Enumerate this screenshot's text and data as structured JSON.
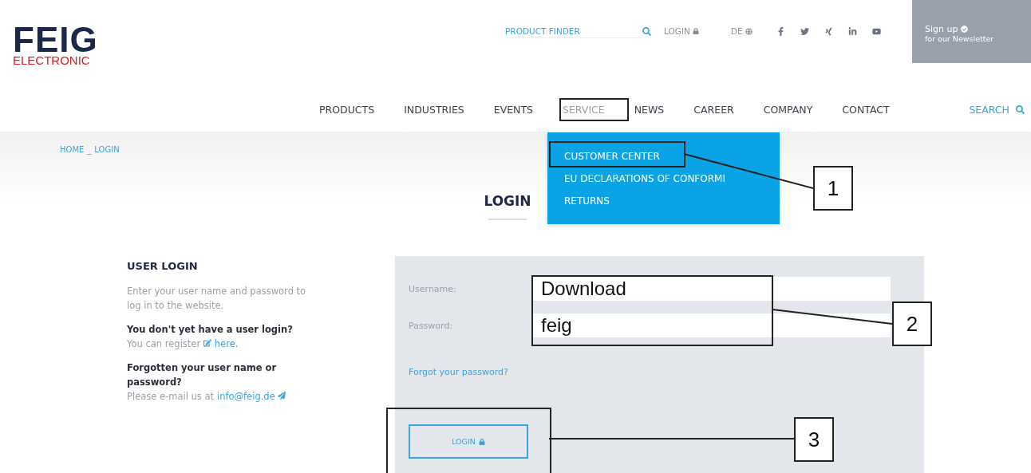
{
  "logo": {
    "name": "FEIG",
    "tagline": "ELECTRONIC"
  },
  "top_bar": {
    "product_finder": {
      "placeholder": "PRODUCT FINDER"
    },
    "login": "LOGIN",
    "language": "DE",
    "newsletter": {
      "title": "Sign up",
      "subtitle": "for our Newsletter"
    }
  },
  "nav": {
    "items": [
      {
        "label": "PRODUCTS",
        "selected": false
      },
      {
        "label": "INDUSTRIES",
        "selected": false
      },
      {
        "label": "EVENTS",
        "selected": false
      },
      {
        "label": "SERVICE",
        "selected": true
      },
      {
        "label": "NEWS",
        "selected": false
      },
      {
        "label": "CAREER",
        "selected": false
      },
      {
        "label": "COMPANY",
        "selected": false
      },
      {
        "label": "CONTACT",
        "selected": false
      }
    ],
    "search": "SEARCH"
  },
  "dropdown": {
    "items": [
      "CUSTOMER CENTER",
      "EU DECLARATIONS OF CONFORMI",
      "RETURNS"
    ]
  },
  "breadcrumb": {
    "items": [
      "HOME",
      "LOGIN"
    ],
    "separator": "_"
  },
  "page_title": "LOGIN",
  "user_login": {
    "title": "USER LOGIN",
    "intro": "Enter your user name and password to log in to the website.",
    "register_question": "You don't yet have a user login?",
    "register_text": "You can register",
    "register_link": "here.",
    "forgot_question": "Forgotten your user name or password?",
    "mail_text": "Please e-mail us at",
    "mail_link": "info@feig.de"
  },
  "form": {
    "fields": [
      {
        "label": "Username:",
        "value": "Download"
      },
      {
        "label": "Password:",
        "value": "feig"
      }
    ],
    "forgot_link": "Forgot your password?",
    "button": "LOGIN"
  },
  "callouts": [
    "1",
    "2",
    "3"
  ]
}
